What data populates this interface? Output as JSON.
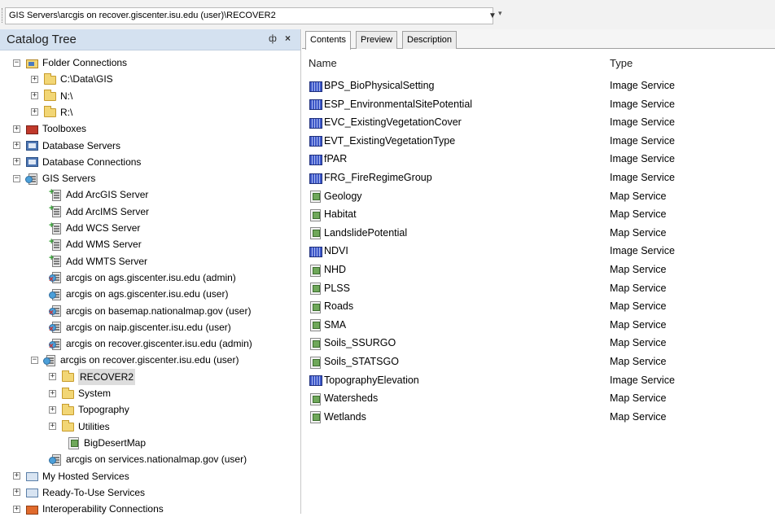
{
  "location": {
    "path": "GIS Servers\\arcgis on recover.giscenter.isu.edu (user)\\RECOVER2"
  },
  "catalog": {
    "title": "Catalog Tree",
    "pin_glyph": "ф",
    "close_glyph": "×",
    "items": [
      {
        "label": "Folder Connections",
        "icon": "folder-connection-icon",
        "expander": "−"
      },
      {
        "label": "C:\\Data\\GIS",
        "icon": "folder-icon",
        "expander": "+"
      },
      {
        "label": "N:\\",
        "icon": "folder-icon",
        "expander": "+"
      },
      {
        "label": "R:\\",
        "icon": "folder-icon",
        "expander": "+"
      },
      {
        "label": "Toolboxes",
        "icon": "toolbox-icon",
        "expander": "+"
      },
      {
        "label": "Database Servers",
        "icon": "database-server-icon",
        "expander": "+"
      },
      {
        "label": "Database Connections",
        "icon": "database-connection-icon",
        "expander": "+"
      },
      {
        "label": "GIS Servers",
        "icon": "gis-servers-icon",
        "expander": "−"
      },
      {
        "label": "Add ArcGIS Server",
        "icon": "add-server-icon"
      },
      {
        "label": "Add ArcIMS Server",
        "icon": "add-server-icon"
      },
      {
        "label": "Add WCS Server",
        "icon": "add-server-icon"
      },
      {
        "label": "Add WMS Server",
        "icon": "add-server-icon"
      },
      {
        "label": "Add WMTS Server",
        "icon": "add-server-icon"
      },
      {
        "label": "arcgis on ags.giscenter.isu.edu (admin)",
        "icon": "admin-server-icon"
      },
      {
        "label": "arcgis on ags.giscenter.isu.edu (user)",
        "icon": "user-server-icon"
      },
      {
        "label": "arcgis on basemap.nationalmap.gov (user)",
        "icon": "admin-server-icon"
      },
      {
        "label": "arcgis on naip.giscenter.isu.edu (user)",
        "icon": "admin-server-icon"
      },
      {
        "label": "arcgis on recover.giscenter.isu.edu (admin)",
        "icon": "admin-server-icon"
      },
      {
        "label": "arcgis on recover.giscenter.isu.edu (user)",
        "icon": "user-server-icon",
        "expander": "−"
      },
      {
        "label": "RECOVER2",
        "icon": "open-folder-icon",
        "expander": "+"
      },
      {
        "label": "System",
        "icon": "folder-icon",
        "expander": "+"
      },
      {
        "label": "Topography",
        "icon": "folder-icon",
        "expander": "+"
      },
      {
        "label": "Utilities",
        "icon": "folder-icon",
        "expander": "+"
      },
      {
        "label": "BigDesertMap",
        "icon": "map-service-icon"
      },
      {
        "label": "arcgis on services.nationalmap.gov (user)",
        "icon": "user-server-icon"
      },
      {
        "label": "My Hosted Services",
        "icon": "hosted-services-icon",
        "expander": "+"
      },
      {
        "label": "Ready-To-Use Services",
        "icon": "hosted-services-icon",
        "expander": "+"
      },
      {
        "label": "Interoperability Connections",
        "icon": "interoperability-icon",
        "expander": "+"
      }
    ]
  },
  "tabs": [
    "Contents",
    "Preview",
    "Description"
  ],
  "contents": {
    "columns": {
      "name": "Name",
      "type": "Type"
    },
    "rows": [
      {
        "name": "BPS_BioPhysicalSetting",
        "type": "Image Service",
        "icon": "image-service-icon"
      },
      {
        "name": "ESP_EnvironmentalSitePotential",
        "type": "Image Service",
        "icon": "image-service-icon"
      },
      {
        "name": "EVC_ExistingVegetationCover",
        "type": "Image Service",
        "icon": "image-service-icon"
      },
      {
        "name": "EVT_ExistingVegetationType",
        "type": "Image Service",
        "icon": "image-service-icon"
      },
      {
        "name": "fPAR",
        "type": "Image Service",
        "icon": "image-service-icon"
      },
      {
        "name": "FRG_FireRegimeGroup",
        "type": "Image Service",
        "icon": "image-service-icon"
      },
      {
        "name": "Geology",
        "type": "Map Service",
        "icon": "map-service-icon"
      },
      {
        "name": "Habitat",
        "type": "Map Service",
        "icon": "map-service-icon"
      },
      {
        "name": "LandslidePotential",
        "type": "Map Service",
        "icon": "map-service-icon"
      },
      {
        "name": "NDVI",
        "type": "Image Service",
        "icon": "image-service-icon"
      },
      {
        "name": "NHD",
        "type": "Map Service",
        "icon": "map-service-icon"
      },
      {
        "name": "PLSS",
        "type": "Map Service",
        "icon": "map-service-icon"
      },
      {
        "name": "Roads",
        "type": "Map Service",
        "icon": "map-service-icon"
      },
      {
        "name": "SMA",
        "type": "Map Service",
        "icon": "map-service-icon"
      },
      {
        "name": "Soils_SSURGO",
        "type": "Map Service",
        "icon": "map-service-icon"
      },
      {
        "name": "Soils_STATSGO",
        "type": "Map Service",
        "icon": "map-service-icon"
      },
      {
        "name": "TopographyElevation",
        "type": "Image Service",
        "icon": "image-service-icon"
      },
      {
        "name": "Watersheds",
        "type": "Map Service",
        "icon": "map-service-icon"
      },
      {
        "name": "Wetlands",
        "type": "Map Service",
        "icon": "map-service-icon"
      }
    ]
  }
}
